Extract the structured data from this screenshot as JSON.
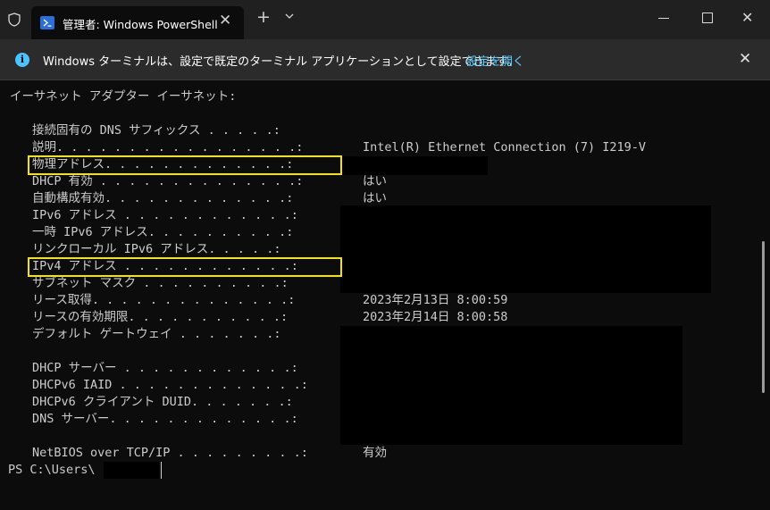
{
  "tab": {
    "title": "管理者: Windows PowerShell"
  },
  "icons": {
    "shield": "shield-icon",
    "powershell": "powershell-icon",
    "close": "close-icon",
    "new_tab": "plus-icon",
    "dropdown": "chevron-down-icon",
    "info": "info-icon"
  },
  "infobar": {
    "message": "Windows ターミナルは、設定で既定のターミナル アプリケーションとして設定できます。",
    "link": "設定を開く"
  },
  "terminal": {
    "header": "イーサネット アダプター イーサネット:",
    "rows": [
      {
        "label": "接続固有の DNS サフィックス . . . . .:",
        "value": ""
      },
      {
        "label": "説明. . . . . . . . . . . . . . . . .:",
        "value": "Intel(R) Ethernet Connection (7) I219-V"
      },
      {
        "label": "物理アドレス. . . . . . . . . . . . .:",
        "value": ""
      },
      {
        "label": "DHCP 有効 . . . . . . . . . . . . . .:",
        "value": "はい"
      },
      {
        "label": "自動構成有効. . . . . . . . . . . . .:",
        "value": "はい"
      },
      {
        "label": "IPv6 アドレス . . . . . . . . . . . .:",
        "value": ""
      },
      {
        "label": "一時 IPv6 アドレス. . . . . . . . . .:",
        "value": ""
      },
      {
        "label": "リンクローカル IPv6 アドレス. . . . .:",
        "value": ""
      },
      {
        "label": "IPv4 アドレス . . . . . . . . . . . .:",
        "value": ""
      },
      {
        "label": "サブネット マスク . . . . . . . . . .:",
        "value": ""
      },
      {
        "label": "リース取得. . . . . . . . . . . . . .:",
        "value": "2023年2月13日 8:00:59"
      },
      {
        "label": "リースの有効期限. . . . . . . . . . .:",
        "value": "2023年2月14日 8:00:58"
      },
      {
        "label": "デフォルト ゲートウェイ . . . . . . .:",
        "value": ""
      },
      {
        "label": "DHCP サーバー . . . . . . . . . . . .:",
        "value": ""
      },
      {
        "label": "DHCPv6 IAID . . . . . . . . . . . . .:",
        "value": ""
      },
      {
        "label": "DHCPv6 クライアント DUID. . . . . . .:",
        "value": ""
      },
      {
        "label": "DNS サーバー. . . . . . . . . . . . .:",
        "value": ""
      },
      {
        "label": "NetBIOS over TCP/IP . . . . . . . . .:",
        "value": "有効"
      }
    ],
    "prompt": "PS C:\\Users\\"
  }
}
